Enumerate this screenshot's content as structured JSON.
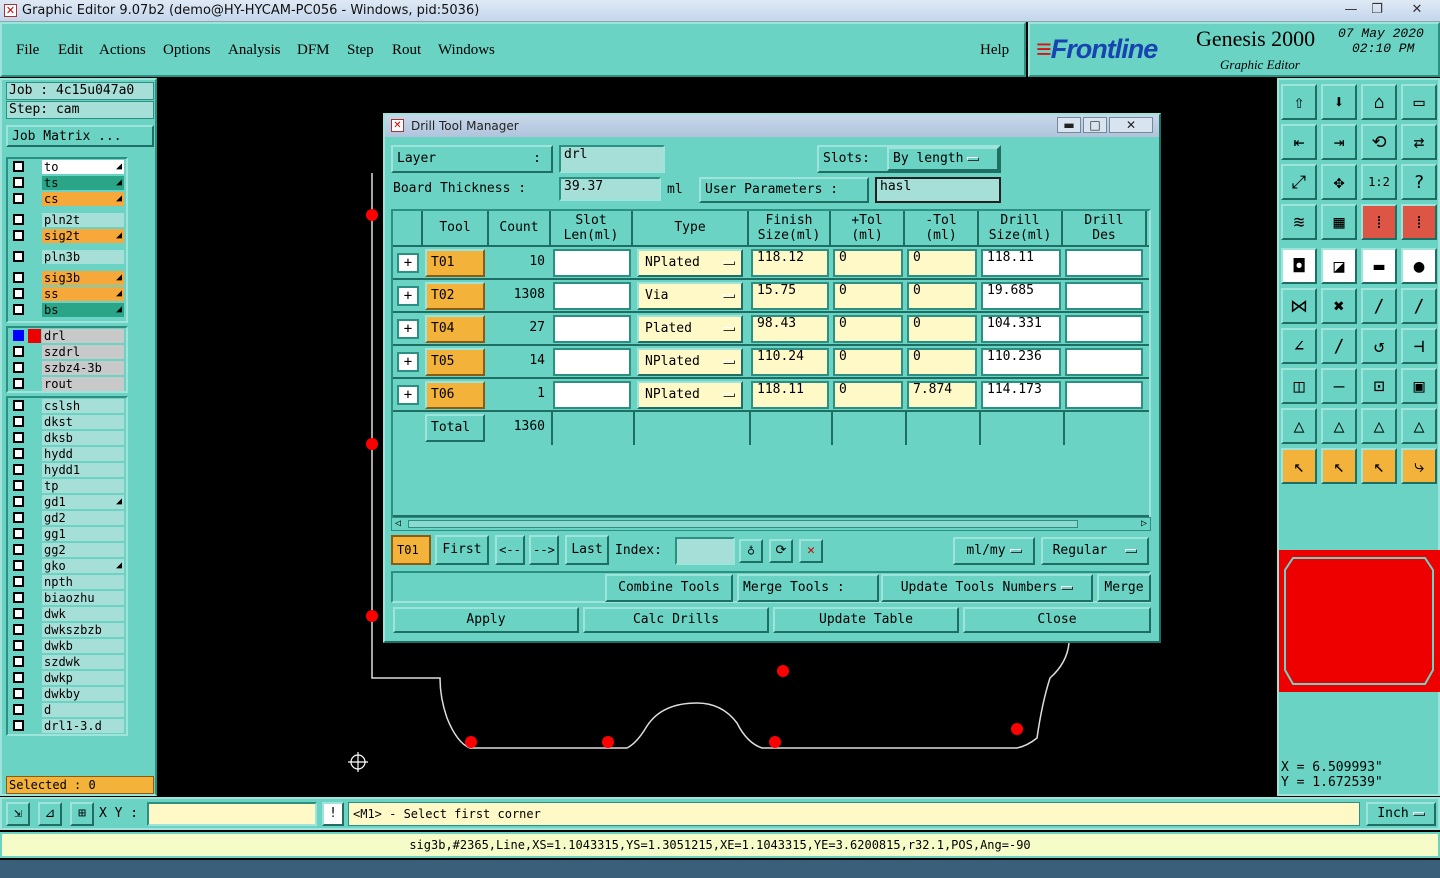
{
  "window": {
    "title": "Graphic Editor 9.07b2 (demo@HY-HYCAM-PC056 - Windows, pid:5036)"
  },
  "menu": [
    "File",
    "Edit",
    "Actions",
    "Options",
    "Analysis",
    "DFM",
    "Step",
    "Rout",
    "Windows"
  ],
  "help": "Help",
  "brand": {
    "logo": "Frontline",
    "product": "Genesis 2000",
    "subtitle": "Graphic Editor",
    "date": "07 May 2020",
    "time": "02:10 PM"
  },
  "job": {
    "job": "Job : 4c15u047a0",
    "step": "Step: cam",
    "matrix": "Job Matrix ..."
  },
  "layers_group1": [
    {
      "name": "to",
      "style": "w"
    },
    {
      "name": "ts",
      "style": "g"
    },
    {
      "name": "cs",
      "style": "o"
    },
    {
      "name": "pln2t",
      "style": ""
    },
    {
      "name": "sig2t",
      "style": "o"
    },
    {
      "name": "pln3b",
      "style": ""
    },
    {
      "name": "sig3b",
      "style": "o"
    },
    {
      "name": "ss",
      "style": "o"
    },
    {
      "name": "bs",
      "style": "g"
    }
  ],
  "layers_group2": [
    {
      "name": "drl",
      "style": "gr"
    },
    {
      "name": "szdrl",
      "style": "gr"
    },
    {
      "name": "szbz4-3b",
      "style": "gr"
    },
    {
      "name": "rout",
      "style": "gr"
    }
  ],
  "layers_group3": [
    "cslsh",
    "dkst",
    "dksb",
    "hydd",
    "hydd1",
    "tp",
    "gd1",
    "gd2",
    "gg1",
    "gg2",
    "gko",
    "npth",
    "biaozhu",
    "dwk",
    "dwkszbzb",
    "dwkb",
    "szdwk",
    "dwkp",
    "dwkby",
    "d",
    "drl1-3.d"
  ],
  "selected": "Selected : 0",
  "coords": {
    "x": "X = 6.509993\"",
    "y": "Y = 1.672539\""
  },
  "bottom": {
    "xy_label": "X Y :",
    "prompt": "<M1> - Select first corner",
    "units": "Inch"
  },
  "status": "sig3b,#2365,Line,XS=1.1043315,YS=1.3051215,XE=1.1043315,YE=3.6200815,r32.1,POS,Ang=-90",
  "dialog": {
    "title": "Drill Tool Manager",
    "layer_label": "Layer",
    "layer_value": "drl",
    "slots_label": "Slots:",
    "slots_value": "By length",
    "thickness_label": "Board Thickness :",
    "thickness_value": "39.37",
    "thickness_unit": "ml",
    "user_params_label": "User Parameters :",
    "user_params_value": "hasl",
    "headers": [
      "Tool",
      "Count",
      "Slot Len(ml)",
      "Type",
      "Finish Size(ml)",
      "+Tol (ml)",
      "-Tol (ml)",
      "Drill Size(ml)",
      "Drill Des"
    ],
    "rows": [
      {
        "tool": "T01",
        "count": "10",
        "type": "NPlated",
        "finish": "118.12",
        "ptol": "0",
        "ntol": "0",
        "drill": "118.11"
      },
      {
        "tool": "T02",
        "count": "1308",
        "type": "Via",
        "finish": "15.75",
        "ptol": "0",
        "ntol": "0",
        "drill": "19.685"
      },
      {
        "tool": "T04",
        "count": "27",
        "type": "Plated",
        "finish": "98.43",
        "ptol": "0",
        "ntol": "0",
        "drill": "104.331"
      },
      {
        "tool": "T05",
        "count": "14",
        "type": "NPlated",
        "finish": "110.24",
        "ptol": "0",
        "ntol": "0",
        "drill": "110.236"
      },
      {
        "tool": "T06",
        "count": "1",
        "type": "NPlated",
        "finish": "118.11",
        "ptol": "0",
        "ntol": "7.874",
        "drill": "114.173"
      }
    ],
    "total_label": "Total",
    "total_count": "1360",
    "nav": {
      "current": "T01",
      "first": "First",
      "prev": "<--",
      "next": "-->",
      "last": "Last",
      "index": "Index:",
      "units": "ml/my",
      "mode": "Regular"
    },
    "tools": {
      "combine": "Combine Tools",
      "merge_label": "Merge Tools :",
      "update_numbers": "Update Tools Numbers",
      "merge": "Merge"
    },
    "actions": {
      "apply": "Apply",
      "calc": "Calc Drills",
      "update": "Update Table",
      "close": "Close"
    }
  }
}
